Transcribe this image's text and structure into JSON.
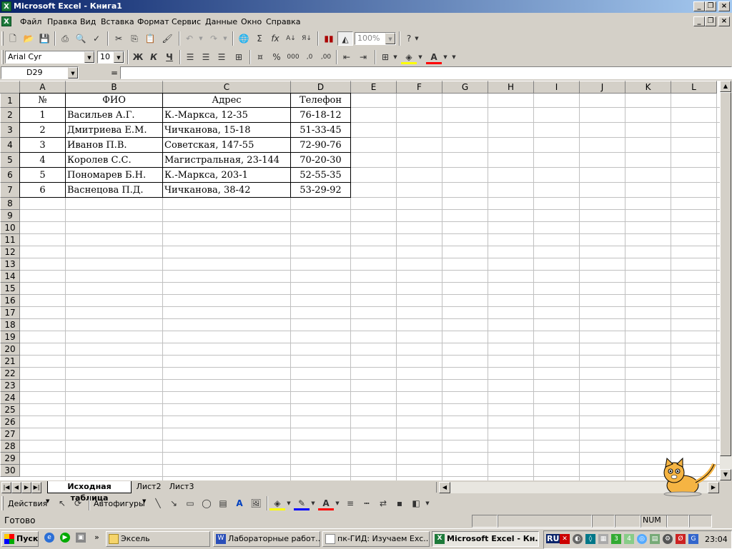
{
  "window": {
    "title": "Microsoft Excel - Книга1"
  },
  "menu": [
    "Файл",
    "Правка",
    "Вид",
    "Вставка",
    "Формат",
    "Сервис",
    "Данные",
    "Окно",
    "Справка"
  ],
  "toolbar": {
    "zoom": "100%",
    "font": "Arial Cyr",
    "size": "10"
  },
  "formula_bar": {
    "name_box": "D29",
    "equals": "="
  },
  "sheet": {
    "columns": [
      "A",
      "B",
      "C",
      "D",
      "E",
      "F",
      "G",
      "H",
      "I",
      "J",
      "K",
      "L"
    ],
    "row_numbers": [
      "1",
      "2",
      "3",
      "4",
      "5",
      "6",
      "7",
      "8",
      "9",
      "10",
      "11",
      "12",
      "13",
      "14",
      "15",
      "16",
      "17",
      "18",
      "19",
      "20",
      "21",
      "22",
      "23",
      "24",
      "25",
      "26",
      "27",
      "28",
      "29",
      "30"
    ],
    "table_headers": [
      "№",
      "ФИО",
      "Адрес",
      "Телефон"
    ],
    "rows": [
      [
        "1",
        "Васильев А.Г.",
        "К.-Маркса, 12-35",
        "76-18-12"
      ],
      [
        "2",
        "Дмитриева Е.М.",
        "Чичканова, 15-18",
        "51-33-45"
      ],
      [
        "3",
        "Иванов П.В.",
        "Советская, 147-55",
        "72-90-76"
      ],
      [
        "4",
        "Королев С.С.",
        "Магистральная, 23-144",
        "70-20-30"
      ],
      [
        "5",
        "Пономарев Б.Н.",
        "К.-Маркса, 203-1",
        "52-55-35"
      ],
      [
        "6",
        "Васнецова П.Д.",
        "Чичканова, 38-42",
        "53-29-92"
      ]
    ]
  },
  "tabs": [
    "Исходная таблица",
    "Лист2",
    "Лист3"
  ],
  "drawing": {
    "actions": "Действия",
    "autoshapes": "Автофигуры"
  },
  "status": {
    "ready": "Готово",
    "num": "NUM"
  },
  "taskbar": {
    "start": "Пуск",
    "tasks": [
      "Эксель",
      "Лабораторные работ...",
      "пк-ГИД: Изучаем Exc...",
      "Microsoft Excel - Кн..."
    ],
    "lang": "RU",
    "clock": "23:04"
  }
}
